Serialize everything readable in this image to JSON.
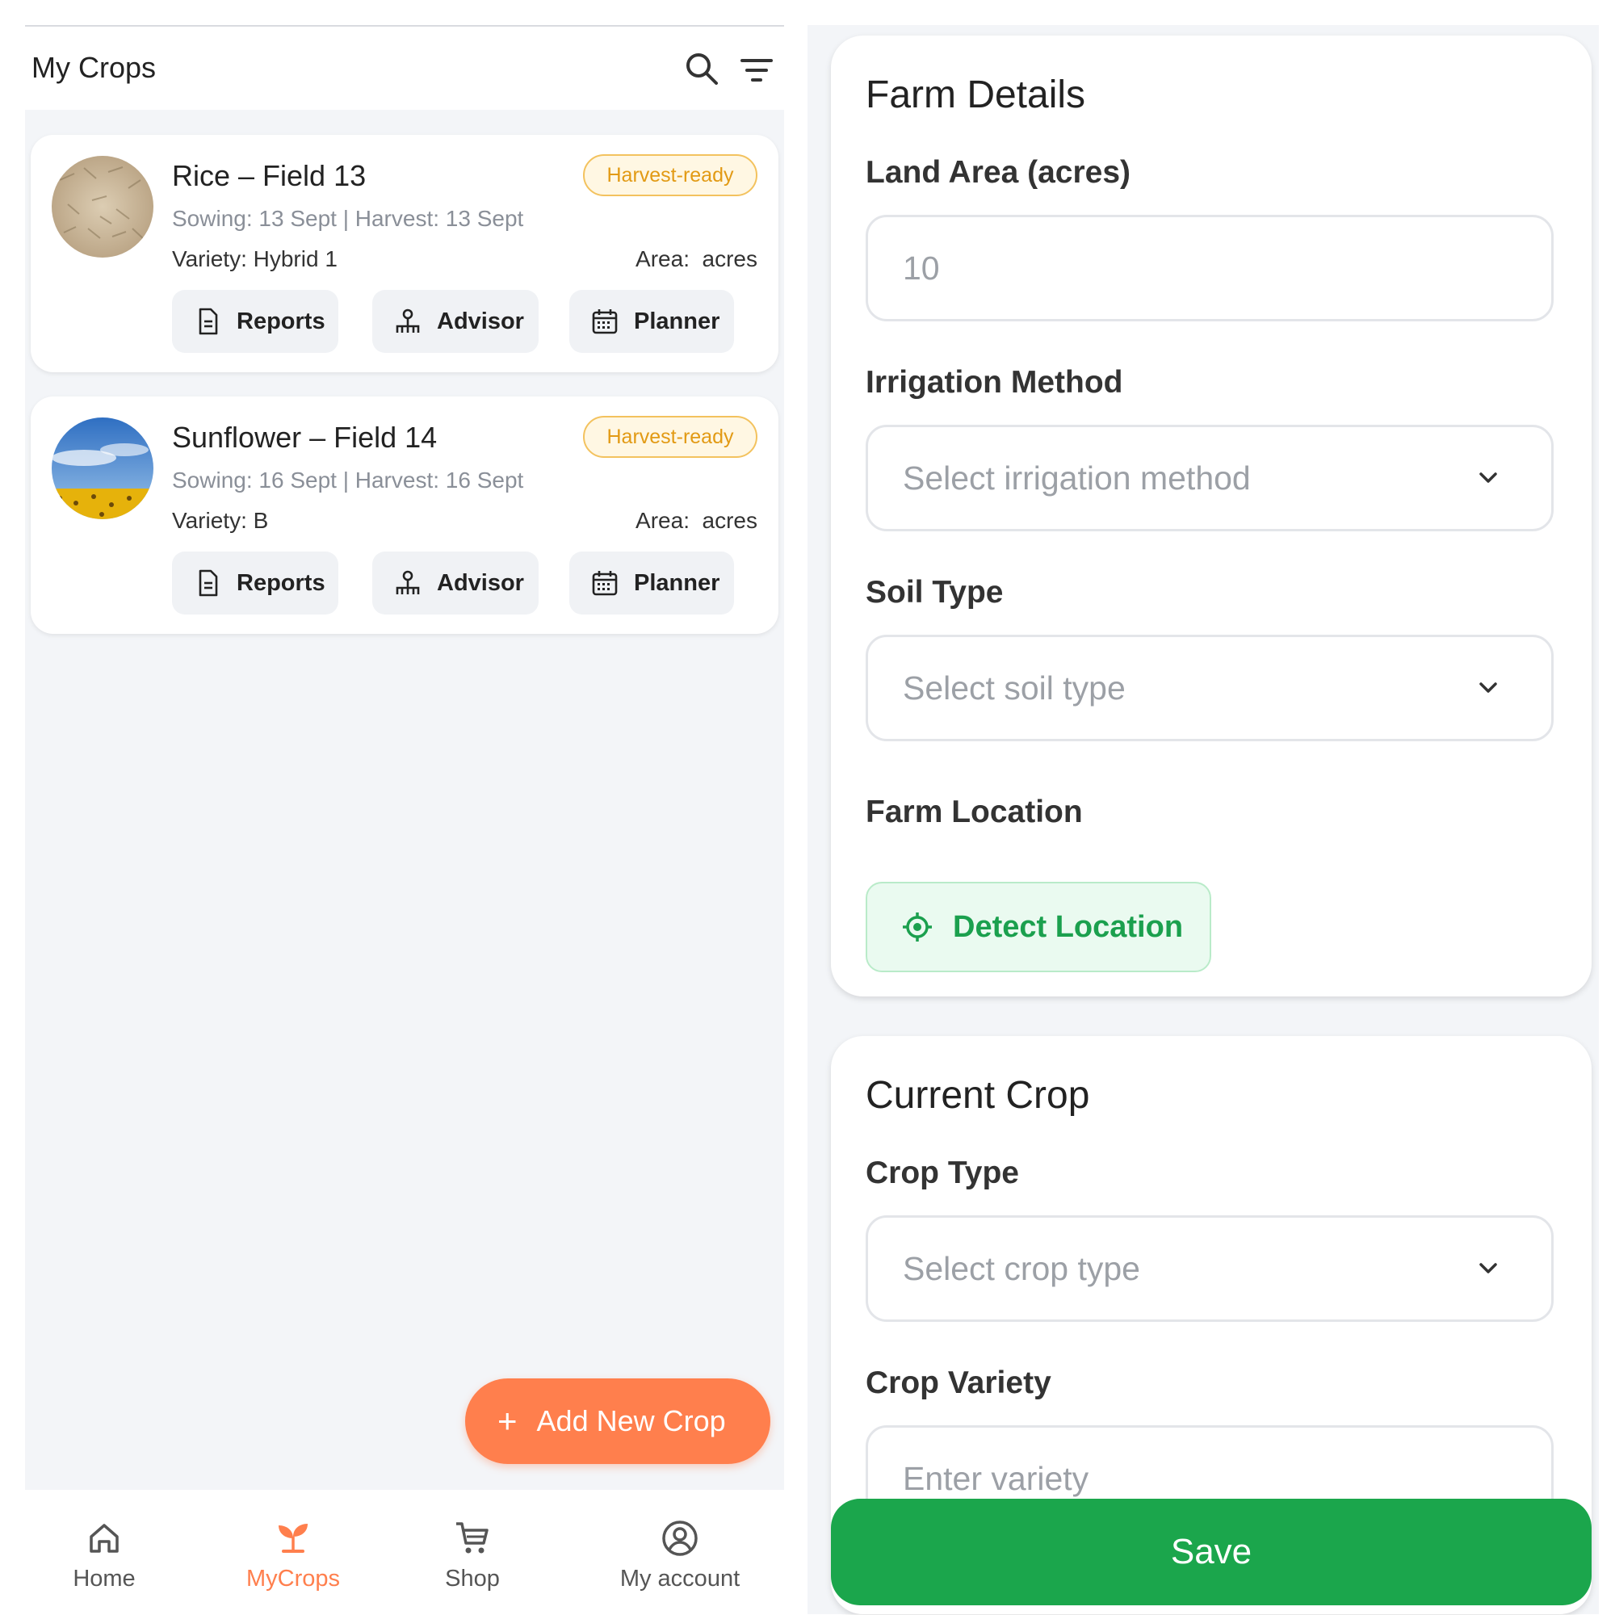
{
  "my_crops": {
    "title": "My Crops",
    "header_icons": [
      "search-icon",
      "filter-icon"
    ],
    "cards": [
      {
        "name": "Rice – Field 13",
        "badge": "Harvest-ready",
        "dates": "Sowing: 13 Sept | Harvest: 13 Sept",
        "variety": "Variety: Hybrid 1",
        "area": "Area:  acres",
        "image": "rice-grains-photo",
        "buttons": {
          "reports": "Reports",
          "advisor": "Advisor",
          "planner": "Planner"
        }
      },
      {
        "name": "Sunflower – Field 14",
        "badge": "Harvest-ready",
        "dates": "Sowing: 16 Sept | Harvest: 16 Sept",
        "variety": "Variety: B",
        "area": "Area:  acres",
        "image": "sunflower-field-photo",
        "buttons": {
          "reports": "Reports",
          "advisor": "Advisor",
          "planner": "Planner"
        }
      }
    ],
    "add_button": {
      "icon": "+",
      "label": "Add New Crop"
    },
    "nav": {
      "items": [
        {
          "label": "Home",
          "icon": "home-icon"
        },
        {
          "label": "MyCrops",
          "icon": "sprout-icon"
        },
        {
          "label": "Shop",
          "icon": "cart-icon"
        },
        {
          "label": "My account",
          "icon": "account-icon"
        }
      ],
      "active": "MyCrops"
    }
  },
  "farm_form": {
    "farm_details": {
      "heading": "Farm Details",
      "land_area_label": "Land Area (acres)",
      "land_area_value": "10",
      "irrigation_label": "Irrigation Method",
      "irrigation_placeholder": "Select irrigation method",
      "soil_label": "Soil Type",
      "soil_placeholder": "Select soil type",
      "location_label": "Farm Location",
      "detect_label": "Detect Location"
    },
    "current_crop": {
      "heading": "Current Crop",
      "crop_type_label": "Crop Type",
      "crop_type_placeholder": "Select crop type",
      "variety_label": "Crop Variety",
      "variety_placeholder": "Enter variety"
    },
    "save_label": "Save"
  },
  "colors": {
    "accent_orange": "#ff7f4d",
    "badge_amber": "#e29a14",
    "primary_green": "#1ba64c",
    "background": "#f3f5f8"
  }
}
